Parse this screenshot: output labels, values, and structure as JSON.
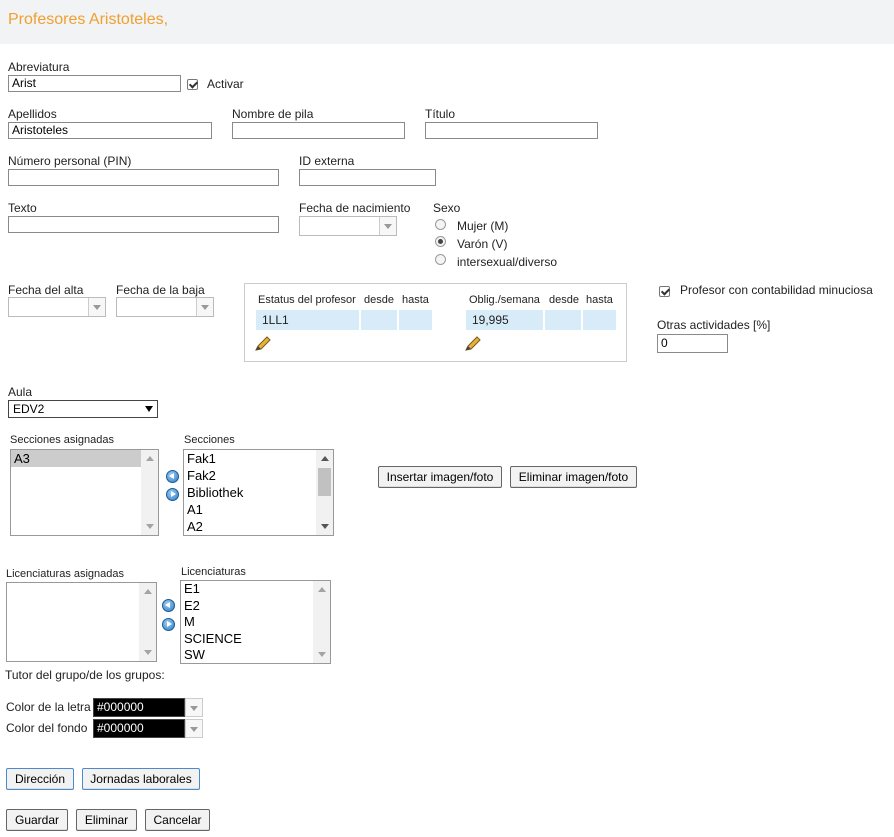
{
  "page": {
    "title": "Profesores Aristoteles,"
  },
  "abbrev": {
    "label": "Abreviatura",
    "value": "Arist",
    "active_label": "Activar",
    "active_checked": true
  },
  "apellidos": {
    "label": "Apellidos",
    "value": "Aristoteles"
  },
  "nombre": {
    "label": "Nombre de pila",
    "value": ""
  },
  "titulo": {
    "label": "Título",
    "value": ""
  },
  "pin": {
    "label": "Número personal (PIN)",
    "value": ""
  },
  "external_id": {
    "label": "ID externa",
    "value": ""
  },
  "texto": {
    "label": "Texto",
    "value": ""
  },
  "birth": {
    "label": "Fecha de nacimiento",
    "value": ""
  },
  "sexo": {
    "label": "Sexo",
    "options": [
      "Mujer (M)",
      "Varón (V)",
      "intersexual/diverso"
    ],
    "selected": "Varón (V)"
  },
  "alta": {
    "label": "Fecha del alta",
    "value": ""
  },
  "baja": {
    "label": "Fecha de la baja",
    "value": ""
  },
  "status_table": {
    "col1": "Estatus del profesor",
    "col2": "desde",
    "col3": "hasta",
    "status_value": "1LL1",
    "col4": "Oblig./semana",
    "col5": "desde",
    "col6": "hasta",
    "oblig_value": "19,995",
    "edit_icon": "pencil-icon"
  },
  "minute_accounting": {
    "label": "Profesor con contabilidad minuciosa",
    "checked": true
  },
  "other_activities": {
    "label": "Otras actividades [%]",
    "value": "0"
  },
  "aula": {
    "label": "Aula",
    "value": "EDV2"
  },
  "secciones_asignadas": {
    "label": "Secciones asignadas",
    "items": [
      "A3"
    ]
  },
  "secciones": {
    "label": "Secciones",
    "items": [
      "Fak1",
      "Fak2",
      "Bibliothek",
      "A1",
      "A2"
    ]
  },
  "image_buttons": {
    "insert": "Insertar imagen/foto",
    "remove": "Eliminar imagen/foto"
  },
  "licenciaturas_asignadas": {
    "label": "Licenciaturas asignadas",
    "items": []
  },
  "licenciaturas": {
    "label": "Licenciaturas",
    "items": [
      "E1",
      "E2",
      "M",
      "SCIENCE",
      "SW"
    ]
  },
  "tutor": {
    "label": "Tutor del grupo/de los grupos:"
  },
  "font_color": {
    "label": "Color de la letra",
    "value": "#000000"
  },
  "bg_color": {
    "label": "Color del fondo",
    "value": "#000000"
  },
  "buttons": {
    "direccion": "Dirección",
    "jornadas": "Jornadas laborales",
    "guardar": "Guardar",
    "eliminar": "Eliminar",
    "cancelar": "Cancelar"
  },
  "colors": {
    "title": "#f0a030",
    "header_bg": "#f2f3f4",
    "table_cell": "#d8ebf8"
  }
}
